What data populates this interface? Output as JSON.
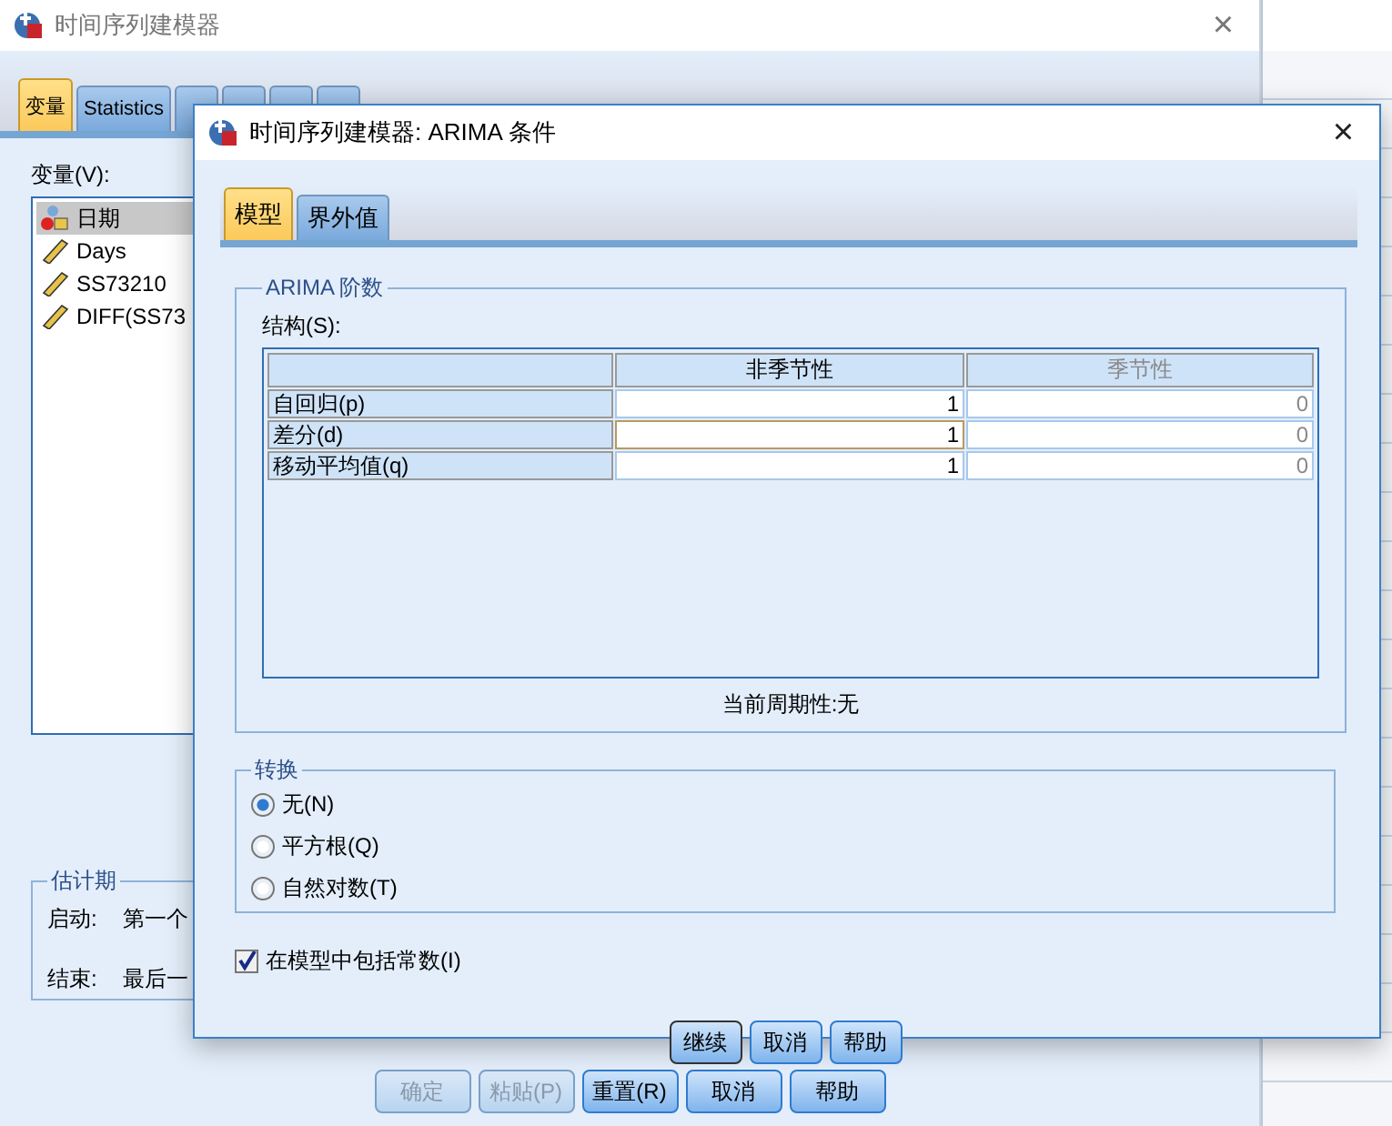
{
  "main_window": {
    "title": "时间序列建模器",
    "close": "×",
    "tabs": [
      {
        "label": "变量",
        "selected": true
      },
      {
        "label": "Statistics",
        "selected": false
      }
    ],
    "variables_label": "变量(V):",
    "variables": [
      {
        "name": "日期",
        "kind": "date",
        "selected": true
      },
      {
        "name": "Days",
        "kind": "scale",
        "selected": false
      },
      {
        "name": "SS73210",
        "kind": "scale",
        "selected": false
      },
      {
        "name": "DIFF(SS73",
        "kind": "scale",
        "selected": false
      }
    ],
    "estimation_period": {
      "title": "估计期",
      "rows": [
        {
          "label": "启动:",
          "value": "第一个"
        },
        {
          "label": "结束:",
          "value": "最后一"
        }
      ]
    },
    "buttons": [
      {
        "label": "确定",
        "disabled": true
      },
      {
        "label": "粘贴(P)",
        "disabled": true
      },
      {
        "label": "重置(R)",
        "disabled": false
      },
      {
        "label": "取消",
        "disabled": false
      },
      {
        "label": "帮助",
        "disabled": false
      }
    ]
  },
  "arima_dialog": {
    "title": "时间序列建模器: ARIMA 条件",
    "close": "×",
    "tabs": [
      {
        "label": "模型",
        "selected": true
      },
      {
        "label": "界外值",
        "selected": false
      }
    ],
    "orders": {
      "title": "ARIMA 阶数",
      "structure_label": "结构(S):",
      "columns": [
        {
          "label": "非季节性",
          "disabled": false
        },
        {
          "label": "季节性",
          "disabled": true
        }
      ],
      "rows": [
        {
          "label": "自回归(p)",
          "nonseasonal": "1",
          "seasonal": "0",
          "focused": false
        },
        {
          "label": "差分(d)",
          "nonseasonal": "1",
          "seasonal": "0",
          "focused": true
        },
        {
          "label": "移动平均值(q)",
          "nonseasonal": "1",
          "seasonal": "0",
          "focused": false
        }
      ],
      "periodicity": "当前周期性:无"
    },
    "transform": {
      "title": "转换",
      "options": [
        {
          "label": "无(N)",
          "selected": true
        },
        {
          "label": "平方根(Q)",
          "selected": false
        },
        {
          "label": "自然对数(T)",
          "selected": false
        }
      ]
    },
    "include_constant": {
      "label": "在模型中包括常数(I)",
      "checked": true
    },
    "buttons": [
      {
        "label": "继续",
        "default": true
      },
      {
        "label": "取消",
        "default": false
      },
      {
        "label": "帮助",
        "default": false
      }
    ]
  }
}
